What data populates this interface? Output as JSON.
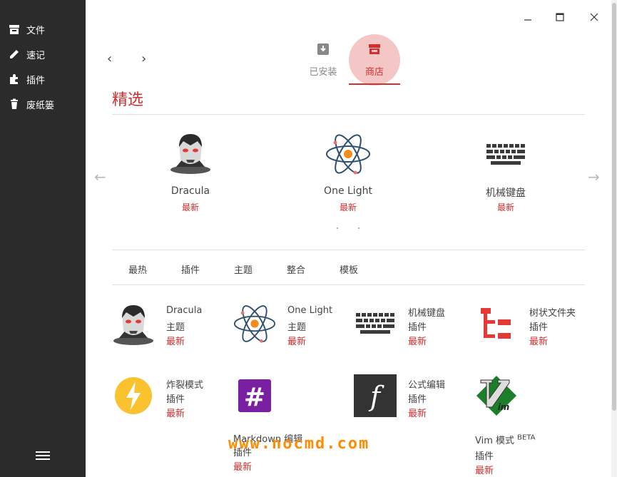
{
  "sidebar": {
    "items": [
      {
        "label": "文件",
        "icon": "archive-icon"
      },
      {
        "label": "速记",
        "icon": "pencil-icon"
      },
      {
        "label": "插件",
        "icon": "puzzle-icon"
      },
      {
        "label": "废纸篓",
        "icon": "trash-icon"
      }
    ],
    "menu_icon": "hamburger-menu-icon"
  },
  "window": {
    "minimize": "minimize-icon",
    "maximize": "maximize-icon",
    "close": "close-icon"
  },
  "nav": {
    "back": "‹",
    "forward": "›"
  },
  "tabs": [
    {
      "label": "已安装",
      "icon": "inbox-download-icon",
      "active": false
    },
    {
      "label": "商店",
      "icon": "store-icon",
      "active": true
    }
  ],
  "featured": {
    "title": "精选",
    "prev_arrow": "←",
    "next_arrow": "→",
    "items": [
      {
        "name": "Dracula",
        "tag": "最新",
        "icon": "dracula-icon"
      },
      {
        "name": "One Light",
        "tag": "最新",
        "icon": "atom-icon"
      },
      {
        "name": "机械键盘",
        "tag": "最新",
        "icon": "keyboard-icon"
      }
    ]
  },
  "categories": [
    "最热",
    "插件",
    "主题",
    "整合",
    "模板"
  ],
  "cards": [
    {
      "name": "Dracula",
      "type": "主题",
      "tag": "最新",
      "icon": "dracula-icon"
    },
    {
      "name": "One Light",
      "type": "主题",
      "tag": "最新",
      "icon": "atom-icon"
    },
    {
      "name": "机械键盘",
      "type": "插件",
      "tag": "最新",
      "icon": "keyboard-icon"
    },
    {
      "name": "树状文件夹",
      "type": "插件",
      "tag": "最新",
      "icon": "tree-folder-icon"
    },
    {
      "name": "炸裂模式",
      "type": "插件",
      "tag": "最新",
      "icon": "lightning-icon"
    },
    {
      "name": "Markdown 编辑",
      "type": "插件",
      "tag": "最新",
      "icon": "hash-icon"
    },
    {
      "name": "公式编辑",
      "type": "插件",
      "tag": "最新",
      "icon": "function-icon"
    },
    {
      "name": "Vim 模式",
      "badge": "BETA",
      "type": "插件",
      "tag": "最新",
      "icon": "vim-icon"
    }
  ],
  "watermark": "www.nocmd.com",
  "colors": {
    "sidebar": "#2b2b2b",
    "accent": "#d32f2f",
    "active_tab_bg": "#f4c6c6",
    "watermark": "#ff8c00"
  }
}
